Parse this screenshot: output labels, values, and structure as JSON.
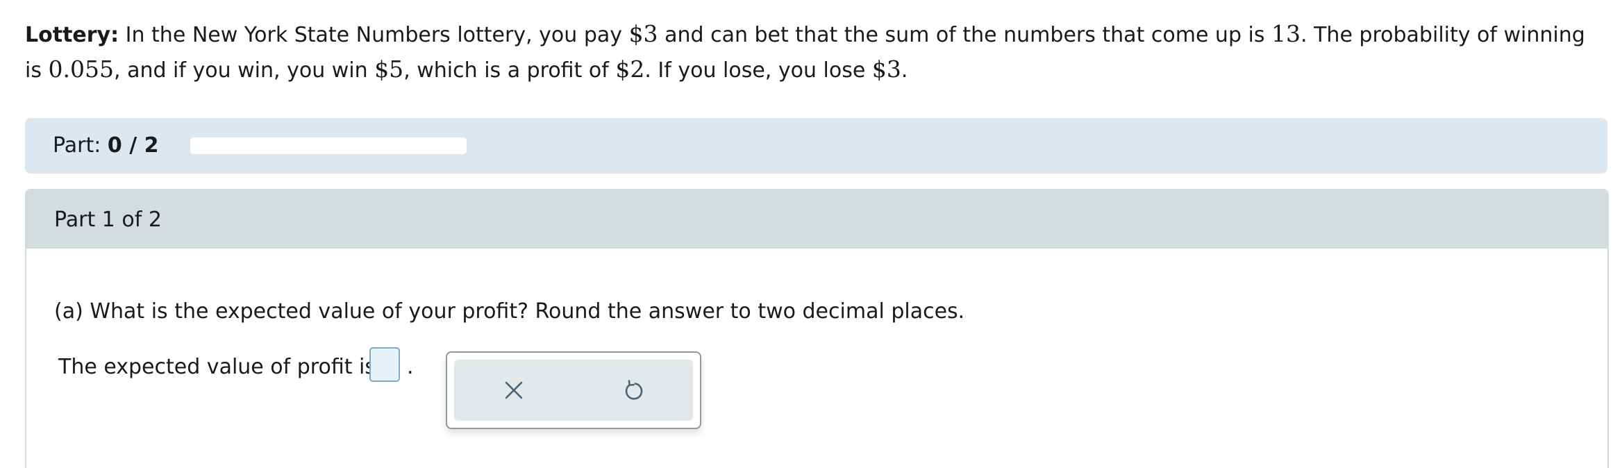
{
  "problem": {
    "label": "Lottery:",
    "text_1": " In the New York State Numbers lottery, you pay ",
    "pay": "$3",
    "text_2": " and can bet that the sum of the numbers that come up is ",
    "sum": "13",
    "text_3": ". The probability of winning is ",
    "probability": "0.055",
    "text_4": ", and if you win, you win ",
    "win": "$5",
    "text_5": ", which is a profit of ",
    "profit": "$2",
    "text_6": ". If you lose, you lose ",
    "lose": "$3",
    "text_7": "."
  },
  "progress": {
    "label": "Part: ",
    "value": "0 / 2",
    "completed": 0,
    "total": 2
  },
  "part": {
    "header": "Part 1 of 2",
    "question": "(a) What is the expected value of your profit? Round the answer to two decimal places.",
    "answer_label": "The expected value of profit is",
    "answer_value": "",
    "answer_suffix": "."
  },
  "tools": {
    "clear_icon": "close-icon",
    "reset_icon": "undo-icon"
  },
  "colors": {
    "part_bar": "#dde7f0",
    "part_header": "#d4dcdf",
    "input_fill": "#e6f2f8",
    "icon": "#4a6275"
  }
}
